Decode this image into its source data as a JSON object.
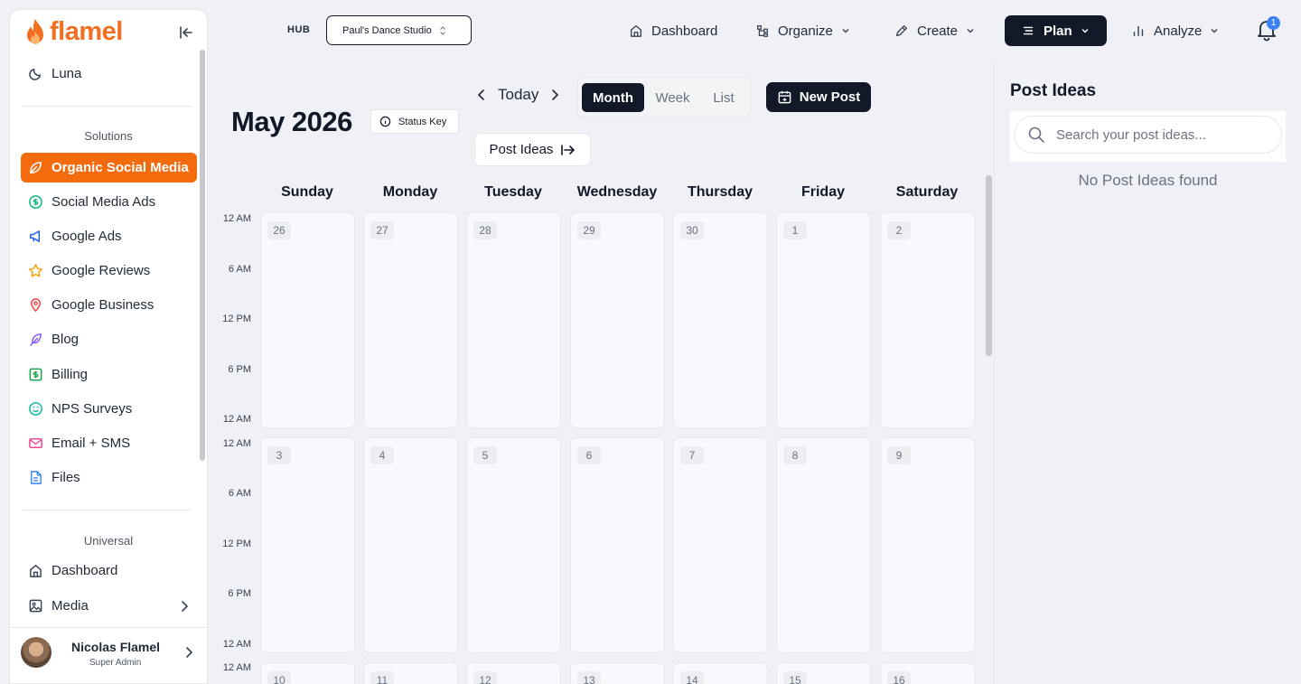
{
  "sidebar": {
    "logo": "flamel",
    "items_top": [
      {
        "label": "Luna",
        "icon": "moon-icon"
      }
    ],
    "solutions_label": "Solutions",
    "solutions": [
      {
        "label": "Organic Social Media",
        "icon": "leaf-icon",
        "color": "#ffffff"
      },
      {
        "label": "Social Media Ads",
        "icon": "dollar-circle-icon",
        "color": "#10b981"
      },
      {
        "label": "Google Ads",
        "icon": "megaphone-icon",
        "color": "#2563eb"
      },
      {
        "label": "Google Reviews",
        "icon": "star-icon",
        "color": "#f59e0b"
      },
      {
        "label": "Google Business",
        "icon": "map-pin-icon",
        "color": "#ef4444"
      },
      {
        "label": "Blog",
        "icon": "feather-icon",
        "color": "#8b5cf6"
      },
      {
        "label": "Billing",
        "icon": "dollar-square-icon",
        "color": "#16a34a"
      },
      {
        "label": "NPS Surveys",
        "icon": "smile-icon",
        "color": "#14b8a6"
      },
      {
        "label": "Email + SMS",
        "icon": "mail-icon",
        "color": "#ec4899"
      },
      {
        "label": "Files",
        "icon": "file-icon",
        "color": "#3b82f6"
      }
    ],
    "universal_label": "Universal",
    "universal": [
      {
        "label": "Dashboard",
        "icon": "home-icon"
      },
      {
        "label": "Media",
        "icon": "image-icon"
      }
    ],
    "user": {
      "name": "Nicolas Flamel",
      "role": "Super Admin"
    }
  },
  "topbar": {
    "hub_label": "HUB",
    "hub_value": "Paul's Dance Studio",
    "nav": [
      {
        "label": "Dashboard",
        "icon": "home-icon"
      },
      {
        "label": "Organize",
        "icon": "hierarchy-icon"
      },
      {
        "label": "Create",
        "icon": "pen-icon"
      },
      {
        "label": "Plan",
        "icon": "list-icon",
        "active": true
      },
      {
        "label": "Analyze",
        "icon": "bar-chart-icon"
      }
    ],
    "notification_count": "1"
  },
  "calendar": {
    "title": "May 2026",
    "status_key": "Status Key",
    "today": "Today",
    "views": [
      "Month",
      "Week",
      "List"
    ],
    "active_view": "Month",
    "new_post": "New Post",
    "post_ideas": "Post Ideas",
    "days": [
      "Sunday",
      "Monday",
      "Tuesday",
      "Wednesday",
      "Thursday",
      "Friday",
      "Saturday"
    ],
    "time_labels": [
      "12 AM",
      "6 AM",
      "12 PM",
      "6 PM",
      "12 AM"
    ],
    "weeks": [
      [
        "26",
        "27",
        "28",
        "29",
        "30",
        "1",
        "2"
      ],
      [
        "3",
        "4",
        "5",
        "6",
        "7",
        "8",
        "9"
      ],
      [
        "10",
        "11",
        "12",
        "13",
        "14",
        "15",
        "16"
      ]
    ]
  },
  "ideas": {
    "title": "Post Ideas",
    "search_placeholder": "Search your post ideas...",
    "empty": "No Post Ideas found"
  }
}
